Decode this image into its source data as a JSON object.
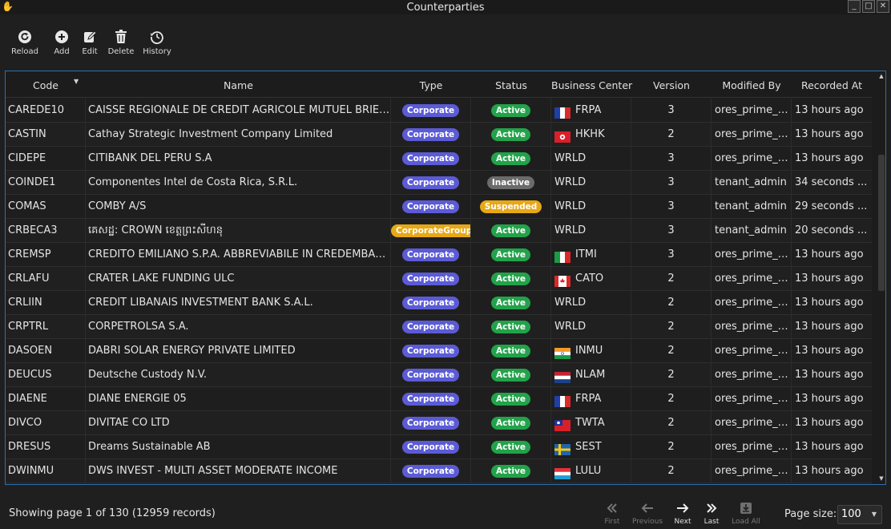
{
  "window": {
    "title": "Counterparties"
  },
  "toolbar": [
    {
      "label": "Reload",
      "icon": "reload-icon"
    },
    {
      "label": "Add",
      "icon": "add-icon"
    },
    {
      "label": "Edit",
      "icon": "edit-icon"
    },
    {
      "label": "Delete",
      "icon": "trash-icon"
    },
    {
      "label": "History",
      "icon": "history-icon"
    }
  ],
  "table": {
    "columns": [
      "Code",
      "Name",
      "Type",
      "Status",
      "Business Center",
      "Version",
      "Modified By",
      "Recorded At"
    ],
    "sort": {
      "column": "Code",
      "direction": "descending"
    },
    "rows": [
      {
        "code": "CAREDE10",
        "name": "CAISSE REGIONALE DE CREDIT AGRICOLE MUTUEL BRIE ...",
        "type": "Corporate",
        "status": "Active",
        "flag": "fr",
        "bc": "FRPA",
        "version": "3",
        "modified_by": "ores_prime_o...",
        "recorded_at": "13 hours ago"
      },
      {
        "code": "CASTIN",
        "name": "Cathay Strategic Investment Company Limited",
        "type": "Corporate",
        "status": "Active",
        "flag": "hk",
        "bc": "HKHK",
        "version": "2",
        "modified_by": "ores_prime_o...",
        "recorded_at": "13 hours ago"
      },
      {
        "code": "CIDEPE",
        "name": "CITIBANK DEL PERU S.A",
        "type": "Corporate",
        "status": "Active",
        "flag": "",
        "bc": "WRLD",
        "version": "3",
        "modified_by": "ores_prime_o...",
        "recorded_at": "13 hours ago"
      },
      {
        "code": "COINDE1",
        "name": "Componentes Intel de Costa Rica, S.R.L.",
        "type": "Corporate",
        "status": "Inactive",
        "flag": "",
        "bc": "WRLD",
        "version": "3",
        "modified_by": "tenant_admin",
        "recorded_at": "34 seconds ..."
      },
      {
        "code": "COMAS",
        "name": "COMBY A/S",
        "type": "Corporate",
        "status": "Suspended",
        "flag": "",
        "bc": "WRLD",
        "version": "3",
        "modified_by": "tenant_admin",
        "recorded_at": "29 seconds ..."
      },
      {
        "code": "CRBECA3",
        "name": "គេសដ្ឋ: CROWN ខេត្តព្រះសីហនុ",
        "type": "CorporateGroup",
        "status": "Active",
        "flag": "",
        "bc": "WRLD",
        "version": "3",
        "modified_by": "tenant_admin",
        "recorded_at": "20 seconds ..."
      },
      {
        "code": "CREMSP",
        "name": "CREDITO EMILIANO S.P.A. ABBREVIABILE IN CREDEMBANCA...",
        "type": "Corporate",
        "status": "Active",
        "flag": "it",
        "bc": "ITMI",
        "version": "3",
        "modified_by": "ores_prime_o...",
        "recorded_at": "13 hours ago"
      },
      {
        "code": "CRLAFU",
        "name": "CRATER LAKE FUNDING ULC",
        "type": "Corporate",
        "status": "Active",
        "flag": "ca",
        "bc": "CATO",
        "version": "2",
        "modified_by": "ores_prime_o...",
        "recorded_at": "13 hours ago"
      },
      {
        "code": "CRLIIN",
        "name": "CREDIT LIBANAIS INVESTMENT BANK S.A.L.",
        "type": "Corporate",
        "status": "Active",
        "flag": "",
        "bc": "WRLD",
        "version": "2",
        "modified_by": "ores_prime_o...",
        "recorded_at": "13 hours ago"
      },
      {
        "code": "CRPTRL",
        "name": "CORPETROLSA S.A.",
        "type": "Corporate",
        "status": "Active",
        "flag": "",
        "bc": "WRLD",
        "version": "2",
        "modified_by": "ores_prime_o...",
        "recorded_at": "13 hours ago"
      },
      {
        "code": "DASOEN",
        "name": "DABRI SOLAR ENERGY PRIVATE LIMITED",
        "type": "Corporate",
        "status": "Active",
        "flag": "in",
        "bc": "INMU",
        "version": "2",
        "modified_by": "ores_prime_o...",
        "recorded_at": "13 hours ago"
      },
      {
        "code": "DEUCUS",
        "name": "Deutsche Custody N.V.",
        "type": "Corporate",
        "status": "Active",
        "flag": "nl",
        "bc": "NLAM",
        "version": "2",
        "modified_by": "ores_prime_o...",
        "recorded_at": "13 hours ago"
      },
      {
        "code": "DIAENE",
        "name": "DIANE ENERGIE 05",
        "type": "Corporate",
        "status": "Active",
        "flag": "fr",
        "bc": "FRPA",
        "version": "2",
        "modified_by": "ores_prime_o...",
        "recorded_at": "13 hours ago"
      },
      {
        "code": "DIVCO",
        "name": "DIVITAE CO LTD",
        "type": "Corporate",
        "status": "Active",
        "flag": "tw",
        "bc": "TWTA",
        "version": "2",
        "modified_by": "ores_prime_o...",
        "recorded_at": "13 hours ago"
      },
      {
        "code": "DRESUS",
        "name": "Dreams Sustainable AB",
        "type": "Corporate",
        "status": "Active",
        "flag": "se",
        "bc": "SEST",
        "version": "2",
        "modified_by": "ores_prime_o...",
        "recorded_at": "13 hours ago"
      },
      {
        "code": "DWINMU",
        "name": "DWS INVEST - MULTI ASSET MODERATE INCOME",
        "type": "Corporate",
        "status": "Active",
        "flag": "lu",
        "bc": "LULU",
        "version": "2",
        "modified_by": "ores_prime_o...",
        "recorded_at": "13 hours ago"
      }
    ]
  },
  "footer": {
    "status": "Showing page 1 of 130 (12959 records)",
    "pagination": [
      {
        "label": "First",
        "icon": "first-page-icon",
        "enabled": false
      },
      {
        "label": "Previous",
        "icon": "arrow-left-icon",
        "enabled": false
      },
      {
        "label": "Next",
        "icon": "arrow-right-icon",
        "enabled": true
      },
      {
        "label": "Last",
        "icon": "last-page-icon",
        "enabled": true
      },
      {
        "label": "Load All",
        "icon": "download-icon",
        "enabled": false
      }
    ],
    "page_size_label": "Page size:",
    "page_size_value": "100"
  },
  "colors": {
    "corporate_badge": "#5b5bd6",
    "group_badge": "#e6a817",
    "active_badge": "#22a34a",
    "inactive_badge": "#6b6b6b",
    "suspended_badge": "#e6a817",
    "selection_border": "#2f6fb0"
  }
}
